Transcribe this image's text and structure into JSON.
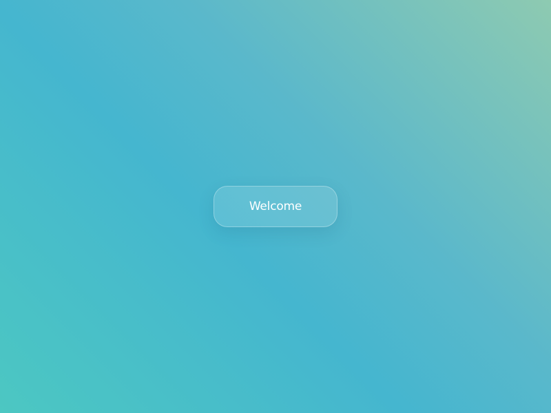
{
  "background": {
    "gradient_colors": [
      "#4cc7c2",
      "#45b6cf",
      "#5ab8cb",
      "#8ecab1"
    ]
  },
  "welcome_button": {
    "label": "Welcome",
    "text_color": "#ffffff"
  }
}
